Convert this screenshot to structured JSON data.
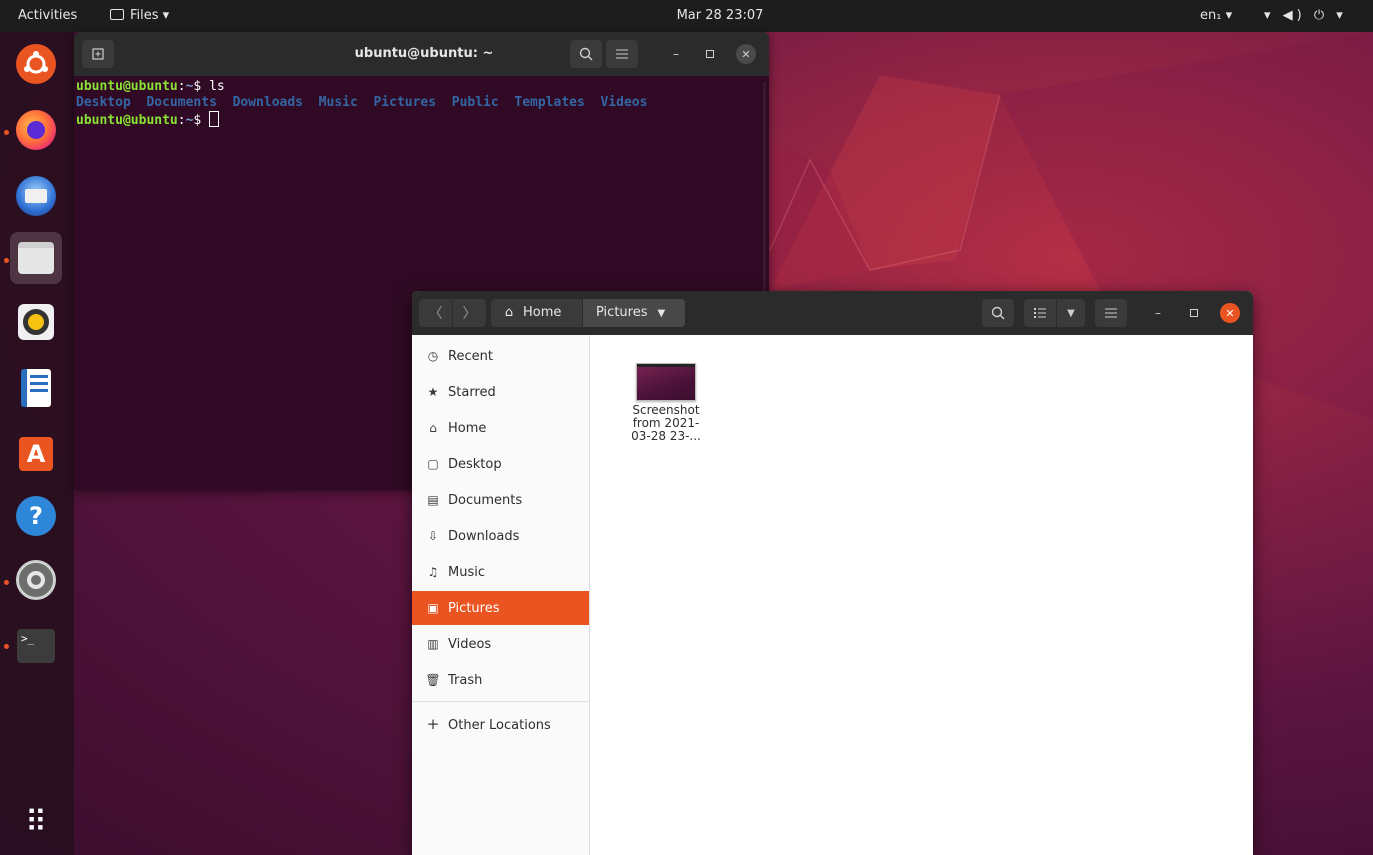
{
  "topbar": {
    "activities": "Activities",
    "app_menu": "Files ▾",
    "clock": "Mar 28  23:07",
    "language": "en₁ ▾",
    "system_icons": "▾ ◀) ⏻ ▾"
  },
  "dock": {
    "items": [
      "ubuntu",
      "firefox",
      "thunderbird",
      "files",
      "rhythmbox",
      "libreoffice-writer",
      "software",
      "help",
      "settings",
      "terminal"
    ],
    "show_apps_glyph": "⠿"
  },
  "terminal": {
    "title": "ubuntu@ubuntu: ~",
    "prompt_user": "ubuntu@ubuntu",
    "prompt_sep": ":",
    "prompt_path": "~",
    "prompt_dollar": "$ ",
    "command": "ls",
    "ls_output": [
      "Desktop",
      "Documents",
      "Downloads",
      "Music",
      "Pictures",
      "Public",
      "Templates",
      "Videos"
    ]
  },
  "files_window": {
    "path_home": "Home",
    "path_current": "Pictures",
    "sidebar": [
      {
        "label": "Recent",
        "icon": "clock-icon"
      },
      {
        "label": "Starred",
        "icon": "star-icon"
      },
      {
        "label": "Home",
        "icon": "home-icon"
      },
      {
        "label": "Desktop",
        "icon": "desktop-icon"
      },
      {
        "label": "Documents",
        "icon": "document-icon"
      },
      {
        "label": "Downloads",
        "icon": "download-icon"
      },
      {
        "label": "Music",
        "icon": "music-icon"
      },
      {
        "label": "Pictures",
        "icon": "picture-icon",
        "selected": true
      },
      {
        "label": "Videos",
        "icon": "video-icon"
      },
      {
        "label": "Trash",
        "icon": "trash-icon"
      },
      {
        "label": "Other Locations",
        "icon": "plus-icon"
      }
    ],
    "files": [
      {
        "name_line1": "Screenshot",
        "name_line2": "from 2021-",
        "name_line3": "03-28 23-..."
      }
    ]
  },
  "colors": {
    "accent": "#e95420",
    "terminal_bg": "#300a24",
    "prompt_green": "#8ae234",
    "dir_blue": "#3465a4"
  }
}
